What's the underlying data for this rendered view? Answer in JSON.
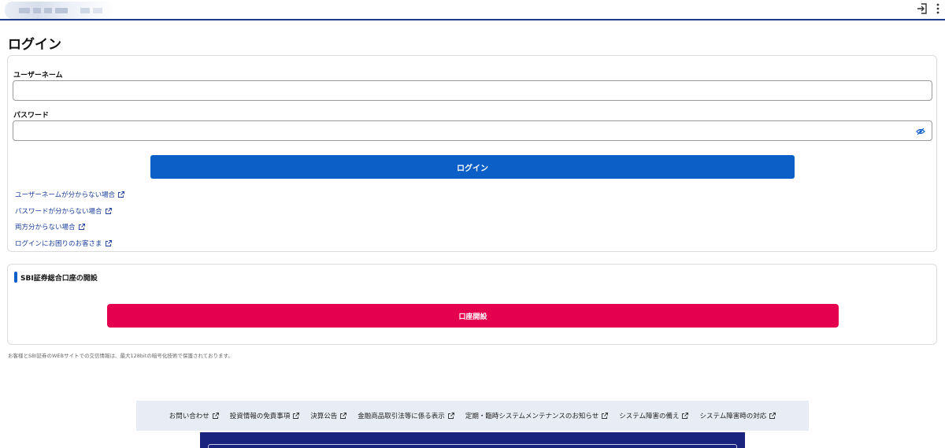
{
  "header": {
    "icons": [
      "login-icon",
      "more-vertical-icon"
    ]
  },
  "page": {
    "title": "ログイン"
  },
  "login_form": {
    "username_label": "ユーザーネーム",
    "username_value": "",
    "password_label": "パスワード",
    "password_value": "",
    "login_button": "ログイン",
    "help_links": [
      "ユーザーネームが分からない場合",
      "パスワードが分からない場合",
      "両方分からない場合",
      "ログインにお困りのお客さま"
    ]
  },
  "account_opening": {
    "title": "SBI証券総合口座の開設",
    "button": "口座開設"
  },
  "security_note": "お客様とSBI証券のWEBサイトでの交信情報は、最大128bitの暗号化技術で保護されております。",
  "footer": {
    "links": [
      "お問い合わせ",
      "投資情報の免責事項",
      "決算公告",
      "金融商品取引法等に係る表示",
      "定期・臨時システムメンテナンスのお知らせ",
      "システム障害の備え",
      "システム障害時の対応"
    ]
  },
  "colors": {
    "primary_blue": "#0b5fc7",
    "open_account_red": "#e5004f",
    "link_blue": "#1a3f9c",
    "footer_navy": "#1a237e"
  }
}
